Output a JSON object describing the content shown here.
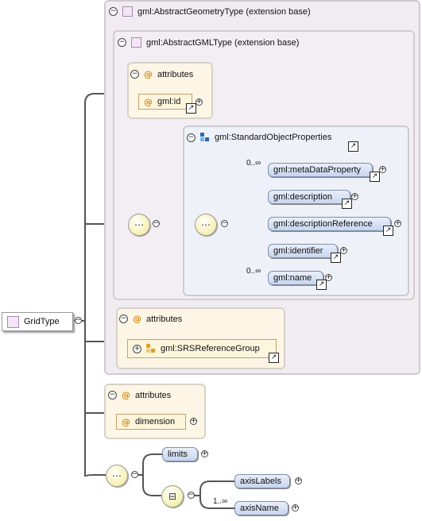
{
  "root": {
    "label": "GridType"
  },
  "ext_base": {
    "label": "gml:AbstractGeometryType (extension base)"
  },
  "ext_inner": {
    "label": "gml:AbstractGMLType (extension base)"
  },
  "attr_group_1": {
    "title": "attributes",
    "items": [
      {
        "label": "gml:id"
      }
    ]
  },
  "std_props": {
    "label": "gml:StandardObjectProperties",
    "elements": [
      {
        "label": "gml:metaDataProperty",
        "occurrence": "0..∞"
      },
      {
        "label": "gml:description",
        "occurrence": ""
      },
      {
        "label": "gml:descriptionReference",
        "occurrence": ""
      },
      {
        "label": "gml:identifier",
        "occurrence": ""
      },
      {
        "label": "gml:name",
        "occurrence": "0..∞"
      }
    ]
  },
  "attr_group_2": {
    "title": "attributes",
    "items": [
      {
        "label": "gml:SRSReferenceGroup"
      }
    ]
  },
  "attr_group_3": {
    "title": "attributes",
    "items": [
      {
        "label": "dimension"
      }
    ]
  },
  "seq_bottom": {
    "limits": {
      "label": "limits"
    },
    "axisLabels": {
      "label": "axisLabels"
    },
    "axisName": {
      "label": "axisName",
      "occurrence": "1..∞"
    }
  },
  "colors": {
    "extension_bg": "#f1ecf2",
    "attributes_bg": "#fdf6e6",
    "element_fill": "#c7d5ee",
    "compositor_fill": "#f6f0b0"
  }
}
